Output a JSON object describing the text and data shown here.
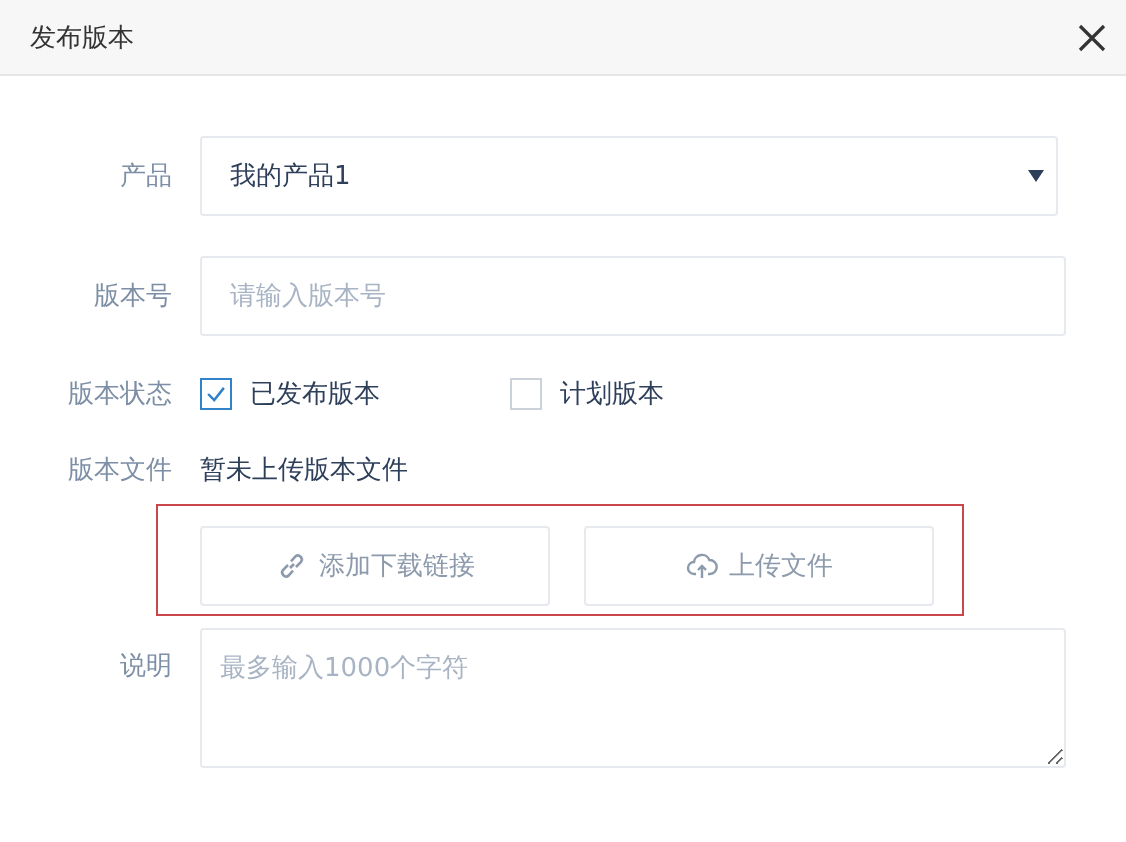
{
  "dialog": {
    "title": "发布版本"
  },
  "product": {
    "label": "产品",
    "value": "我的产品1"
  },
  "version": {
    "label": "版本号",
    "placeholder": "请输入版本号"
  },
  "status": {
    "label": "版本状态",
    "options": [
      {
        "label": "已发布版本",
        "checked": true
      },
      {
        "label": "计划版本",
        "checked": false
      }
    ]
  },
  "file": {
    "label": "版本文件",
    "text": "暂未上传版本文件",
    "highlighted": true,
    "buttons": [
      {
        "kind": "link",
        "label": "添加下载链接"
      },
      {
        "kind": "upload",
        "label": "上传文件"
      }
    ]
  },
  "description": {
    "label": "说明",
    "placeholder": "最多输入1000个字符"
  }
}
